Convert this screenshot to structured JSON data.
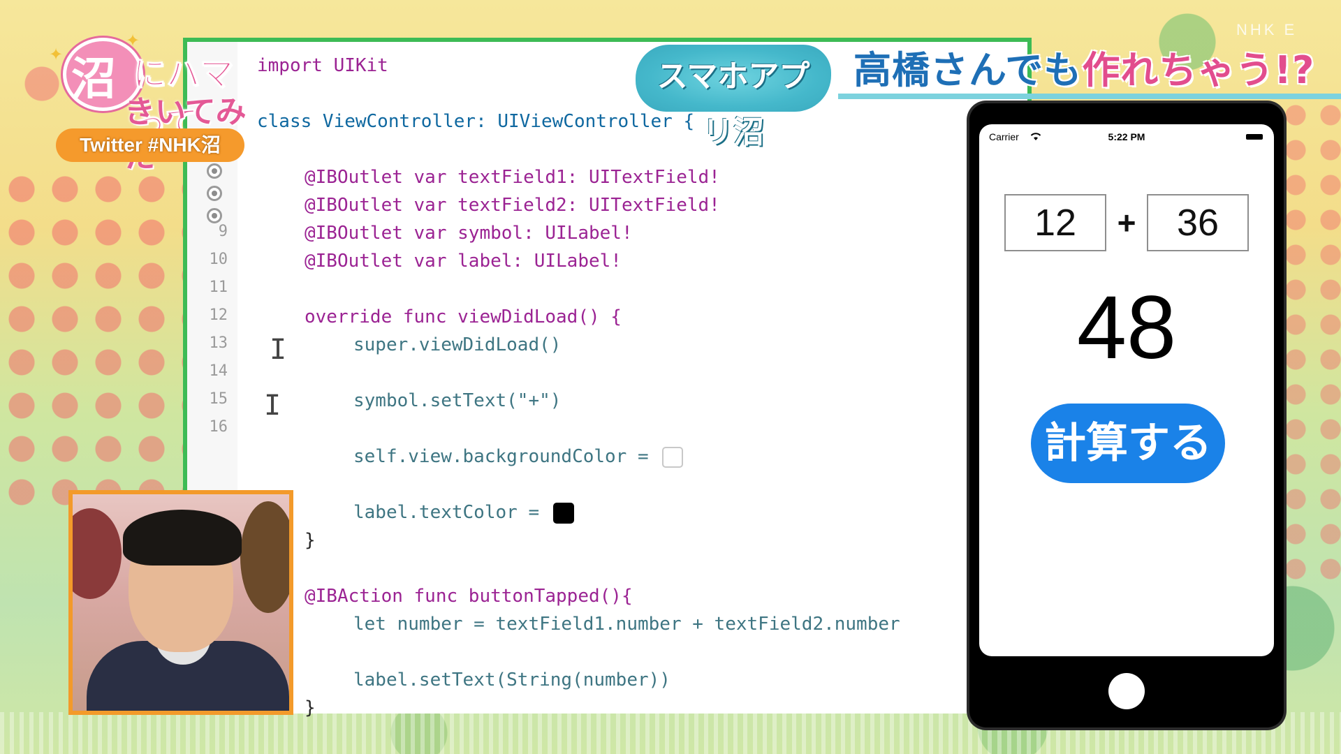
{
  "logo": {
    "numa": "沼",
    "line1": "にハマって",
    "line2": "きいてみた",
    "hashtag": "Twitter #NHK沼"
  },
  "banner": {
    "tag": "スマホアプリ沼",
    "title_part1": "高橋",
    "title_part2": "さんでも",
    "title_part3": "作れちゃう!?",
    "channel": "NHK E"
  },
  "code": {
    "lines": [
      "import UIKit",
      "class ViewController: UIViewController {",
      "@IBOutlet var textField1: UITextField!",
      "@IBOutlet var textField2: UITextField!",
      "@IBOutlet var symbol: UILabel!",
      "@IBOutlet var label: UILabel!",
      "override func viewDidLoad() {",
      "super.viewDidLoad()",
      "symbol.setText(\"+\")",
      "self.view.backgroundColor =",
      "label.textColor =",
      "}",
      "@IBAction func buttonTapped(){",
      "let number = textField1.number + textField2.number",
      "label.setText(String(number))",
      "}"
    ],
    "line_numbers": [
      "9",
      "10",
      "11",
      "12",
      "13",
      "14",
      "15",
      "16"
    ],
    "colors": {
      "background_swatch": "#ffffff",
      "text_swatch": "#000000",
      "keyword": "#9b2393"
    }
  },
  "phone": {
    "carrier": "Carrier",
    "time": "5:22 PM",
    "field1": "12",
    "symbol": "+",
    "field2": "36",
    "result": "48",
    "button": "計算する",
    "button_color": "#1a82e8"
  },
  "accent_colors": {
    "frame": "#3dbb55",
    "inset_border": "#f39a2a"
  }
}
